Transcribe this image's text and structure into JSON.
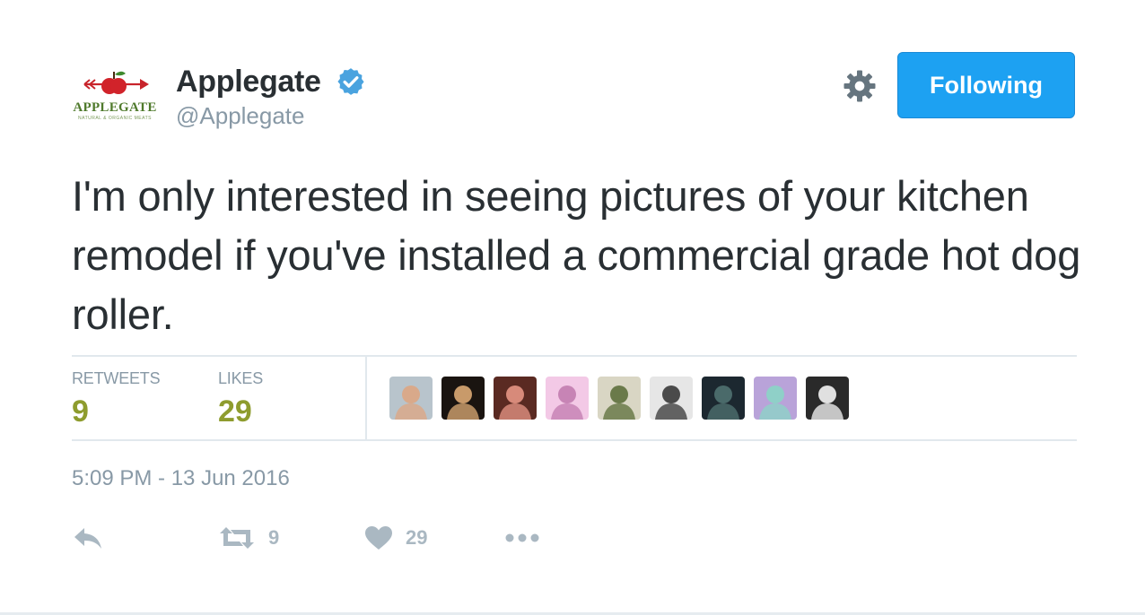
{
  "author": {
    "display_name": "Applegate",
    "handle": "@Applegate",
    "verified": true,
    "avatar": {
      "icon": "applegate-logo",
      "brand_text": "APPLEGATE",
      "brand_tagline": "NATURAL & ORGANIC MEATS"
    }
  },
  "header": {
    "settings_icon": "gear-icon",
    "follow_button_label": "Following"
  },
  "tweet": {
    "text": "I'm only interested in seeing pictures of your kitchen remodel if you've installed a commercial grade hot dog roller.",
    "timestamp": "5:09 PM - 13 Jun 2016"
  },
  "stats": {
    "retweets_label": "RETWEETS",
    "retweets_count": "9",
    "likes_label": "LIKES",
    "likes_count": "29"
  },
  "likers": [
    {
      "name": "liker-avatar-1",
      "bg": "#b8c4cc",
      "fg": "#d9a98a"
    },
    {
      "name": "liker-avatar-2",
      "bg": "#1a1410",
      "fg": "#c89a6a"
    },
    {
      "name": "liker-avatar-3",
      "bg": "#5a2a22",
      "fg": "#d78a7a"
    },
    {
      "name": "liker-avatar-4",
      "bg": "#f3c9e6",
      "fg": "#c784b5"
    },
    {
      "name": "liker-avatar-5",
      "bg": "#d9d6c4",
      "fg": "#6a7a4a"
    },
    {
      "name": "liker-avatar-6",
      "bg": "#e6e6e6",
      "fg": "#4a4a4a"
    },
    {
      "name": "liker-avatar-7",
      "bg": "#1c2830",
      "fg": "#4a6a6a"
    },
    {
      "name": "liker-avatar-8",
      "bg": "#b9a3d9",
      "fg": "#8fd0c8"
    },
    {
      "name": "liker-avatar-9",
      "bg": "#2a2a2a",
      "fg": "#e0e0e0"
    }
  ],
  "actions": {
    "reply_icon": "reply-icon",
    "retweet_icon": "retweet-icon",
    "retweet_count": "9",
    "like_icon": "heart-icon",
    "like_count": "29",
    "more_icon": "more-dots-icon"
  },
  "colors": {
    "accent": "#1da1f2",
    "stat_value": "#8e9c2e",
    "muted": "#8899a6",
    "action_gray": "#aab8c2",
    "text": "#292f33"
  }
}
